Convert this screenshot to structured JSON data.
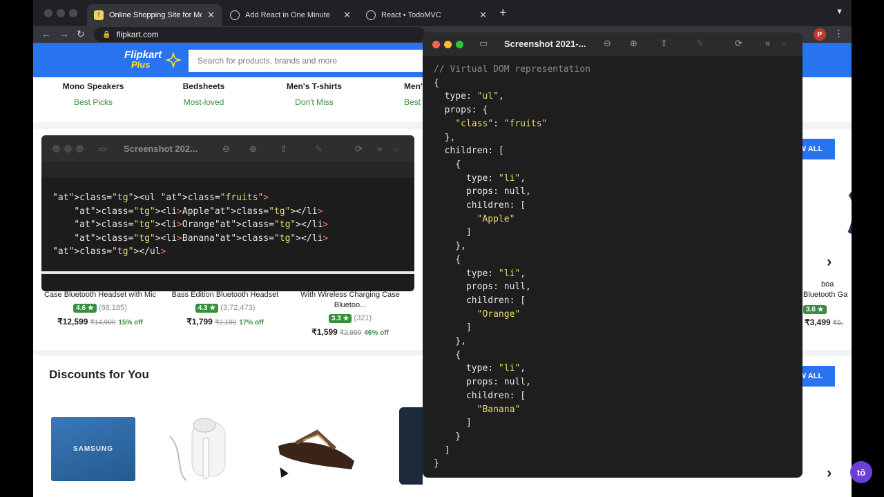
{
  "browser": {
    "tabs": [
      {
        "title": "Online Shopping Site for Mobile",
        "active": true
      },
      {
        "title": "Add React in One Minute",
        "active": false
      },
      {
        "title": "React • TodoMVC",
        "active": false
      }
    ],
    "new_tab": "+",
    "url": "flipkart.com",
    "profile_initial": "P"
  },
  "flipkart": {
    "logo_line1": "Flipkart",
    "logo_line2": "Plus",
    "search_placeholder": "Search for products, brands and more",
    "categories": [
      {
        "name": "Mono Speakers",
        "tag": "Best Picks"
      },
      {
        "name": "Bedsheets",
        "tag": "Most-loved"
      },
      {
        "name": "Men's T-shirts",
        "tag": "Don't Miss"
      },
      {
        "name": "Men's",
        "tag": "Best"
      }
    ],
    "products": [
      {
        "name": "Case Bluetooth Headset with Mic",
        "rating": "4.6 ★",
        "reviews": "(68,185)",
        "price": "₹12,599",
        "orig": "₹14,900",
        "off": "15% off"
      },
      {
        "name": "Bass Edition Bluetooth Headset",
        "rating": "4.3 ★",
        "reviews": "(3,72,473)",
        "price": "₹1,799",
        "orig": "₹2,190",
        "off": "17% off"
      },
      {
        "name": "With Wireless Charging Case Bluetoo...",
        "rating": "3.3 ★",
        "reviews": "(321)",
        "price": "₹1,599",
        "orig": "₹2,999",
        "off": "46% off"
      }
    ],
    "right_product": {
      "name_a": "boa",
      "name_b": "Bluetooth Ga",
      "rating": "3.6 ★",
      "price": "₹3,499",
      "orig": "₹9,"
    },
    "view_all": "W ALL",
    "section_title": "Discounts for You",
    "samsung_label": "SAMSUNG"
  },
  "preview_large": {
    "title": "Screenshot 2021-...",
    "lines": [
      "// Virtual DOM representation",
      "{",
      "  type: \"ul\",",
      "  props: {",
      "    \"class\": \"fruits\"",
      "  },",
      "  children: [",
      "    {",
      "      type: \"li\",",
      "      props: null,",
      "      children: [",
      "        \"Apple\"",
      "      ]",
      "    },",
      "    {",
      "      type: \"li\",",
      "      props: null,",
      "      children: [",
      "        \"Orange\"",
      "      ]",
      "    },",
      "    {",
      "      type: \"li\",",
      "      props: null,",
      "      children: [",
      "        \"Banana\"",
      "      ]",
      "    }",
      "  ]",
      "}"
    ]
  },
  "preview_small": {
    "title": "Screenshot 202...",
    "lines": [
      "<ul class=\"fruits\">",
      "    <li>Apple</li>",
      "    <li>Orange</li>",
      "    <li>Banana</li>",
      "</ul>"
    ]
  },
  "toggl_label": "tō",
  "colors": {
    "flipkart_blue": "#2874f0",
    "rating_green": "#388e3c",
    "code_bg": "#1e1e1e"
  }
}
